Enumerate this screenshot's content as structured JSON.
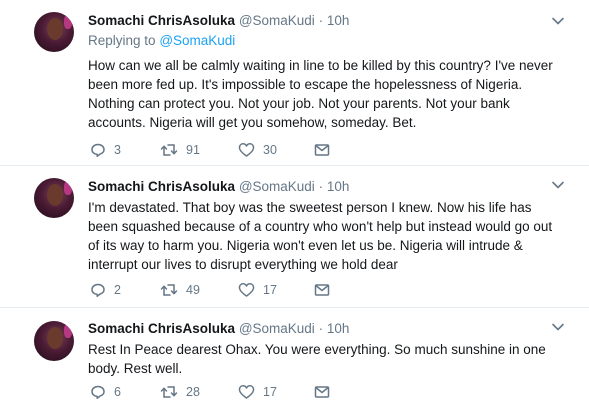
{
  "tweets": [
    {
      "author_name": "Somachi ChrisAsoluka",
      "handle": "@SomaKudi",
      "separator": "·",
      "time": "10h",
      "replying_prefix": "Replying to",
      "replying_to": "@SomaKudi",
      "text": "How can we all be calmly waiting in line to be killed by this country? I've never been more fed up. It's impossible to escape the hopelessness of Nigeria. Nothing can protect you. Not your job.  Not your parents. Not your bank accounts. Nigeria will get you somehow, someday. Bet.",
      "replies": "3",
      "retweets": "91",
      "likes": "30"
    },
    {
      "author_name": "Somachi ChrisAsoluka",
      "handle": "@SomaKudi",
      "separator": "·",
      "time": "10h",
      "text": "I'm devastated. That boy was the sweetest person I knew. Now his life has been squashed because of a country who won't help but instead would go out of its way to harm you. Nigeria won't even let us be. Nigeria will intrude & interrupt our lives to disrupt everything we hold dear",
      "replies": "2",
      "retweets": "49",
      "likes": "17"
    },
    {
      "author_name": "Somachi ChrisAsoluka",
      "handle": "@SomaKudi",
      "separator": "·",
      "time": "10h",
      "text": "Rest In Peace dearest Ohax. You were everything. So much sunshine in one body. Rest well.",
      "replies": "6",
      "retweets": "28",
      "likes": "17"
    }
  ],
  "icons": {
    "reply": "reply-icon",
    "retweet": "retweet-icon",
    "like": "heart-icon",
    "dm": "envelope-icon",
    "menu": "chevron-down-icon"
  },
  "colors": {
    "link": "#1da1f2",
    "secondary_text": "#657786",
    "primary_text": "#14171a",
    "divider": "#e6ecf0"
  }
}
